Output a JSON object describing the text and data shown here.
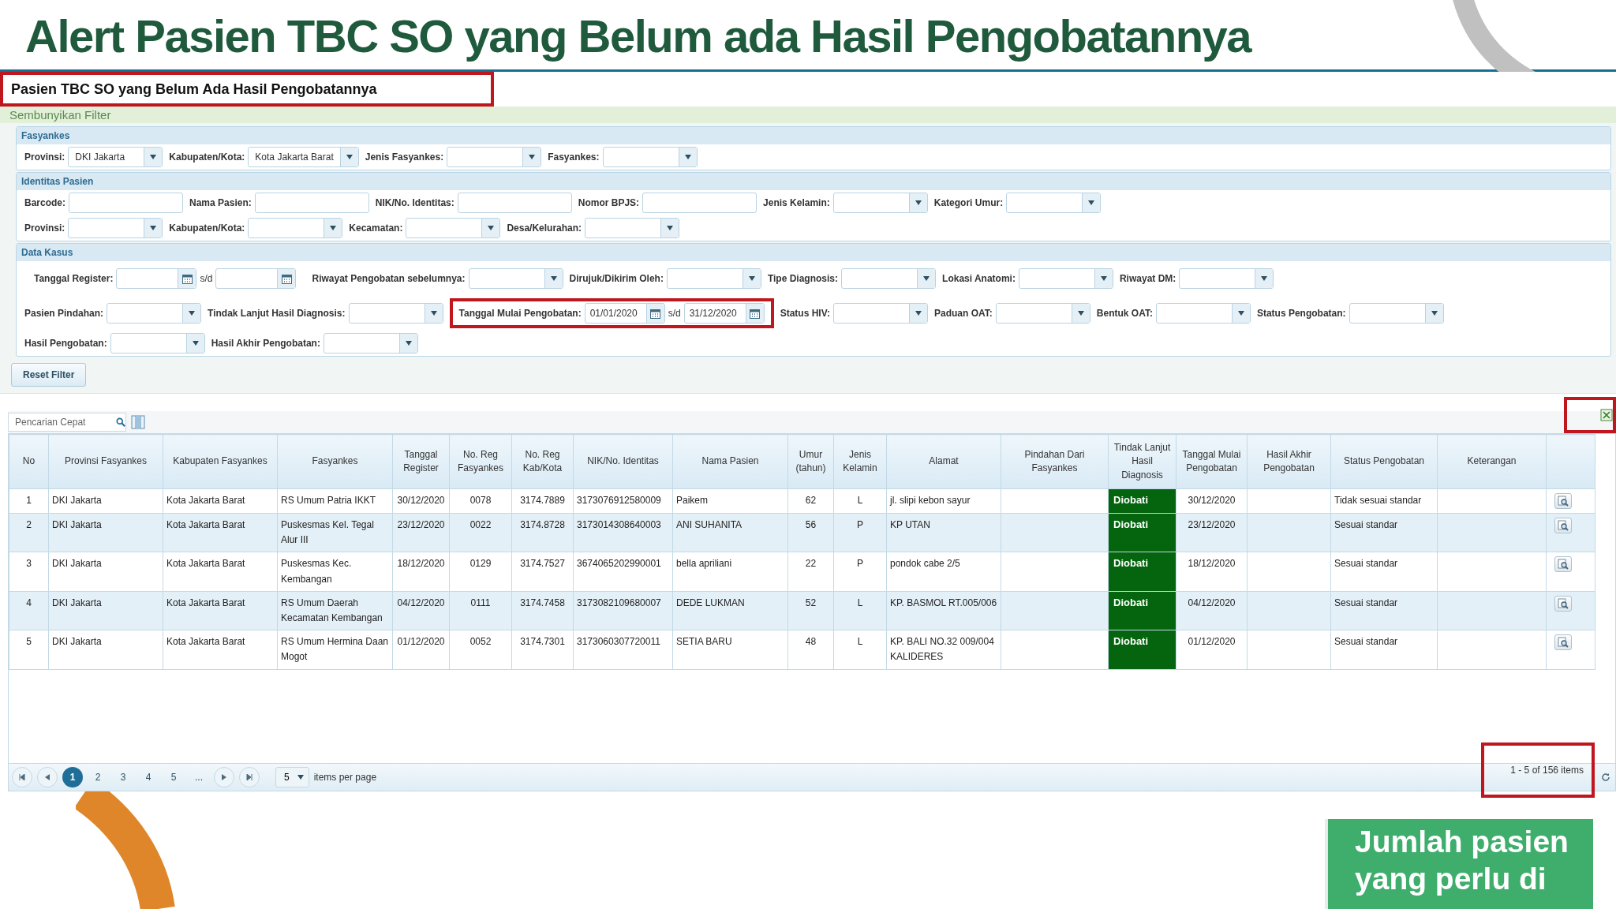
{
  "slide": {
    "title": "Alert Pasien TBC SO yang Belum ada Hasil Pengobatannya",
    "callout": "Jumlah pasien yang perlu di"
  },
  "panel": {
    "title": "Pasien TBC SO yang Belum Ada Hasil Pengobatannya",
    "title_highlighted": true,
    "filter_toggle": "Sembunyikan Filter"
  },
  "filter_groups": [
    {
      "title": "Fasyankes",
      "rows": [
        [
          {
            "label": "Provinsi:",
            "kind": "select",
            "value": "DKI Jakarta"
          },
          {
            "label": "Kabupaten/Kota:",
            "kind": "select",
            "value": "Kota Jakarta Barat"
          },
          {
            "label": "Jenis Fasyankes:",
            "kind": "select"
          },
          {
            "label": "Fasyankes:",
            "kind": "select"
          }
        ]
      ]
    },
    {
      "title": "Identitas Pasien",
      "rows": [
        [
          {
            "label": "Barcode:",
            "kind": "text"
          },
          {
            "label": "Nama Pasien:",
            "kind": "text"
          },
          {
            "label": "NIK/No. Identitas:",
            "kind": "text"
          },
          {
            "label": "Nomor BPJS:",
            "kind": "text"
          },
          {
            "label": "Jenis Kelamin:",
            "kind": "select"
          },
          {
            "label": "Kategori Umur:",
            "kind": "select"
          }
        ],
        [
          {
            "label": "Provinsi:",
            "kind": "select"
          },
          {
            "label": "Kabupaten/Kota:",
            "kind": "select"
          },
          {
            "label": "Kecamatan:",
            "kind": "select"
          },
          {
            "label": "Desa/Kelurahan:",
            "kind": "select"
          }
        ]
      ]
    },
    {
      "title": "Data Kasus",
      "rows": [
        [
          {
            "label": "Tanggal Register:",
            "kind": "date_range",
            "separator": "s/d"
          },
          {
            "label": "Riwayat Pengobatan sebelumnya:",
            "kind": "select"
          },
          {
            "label": "Dirujuk/Dikirim Oleh:",
            "kind": "select"
          },
          {
            "label": "Tipe Diagnosis:",
            "kind": "select"
          },
          {
            "label": "Lokasi Anatomi:",
            "kind": "select"
          },
          {
            "label": "Riwayat DM:",
            "kind": "select"
          }
        ],
        [
          {
            "label": "Pasien Pindahan:",
            "kind": "select"
          },
          {
            "label": "Tindak Lanjut Hasil Diagnosis:",
            "kind": "select"
          },
          {
            "label": "Tanggal Mulai Pengobatan:",
            "kind": "date_range",
            "from": "01/01/2020",
            "separator": "s/d",
            "to": "31/12/2020",
            "highlighted": true
          },
          {
            "label": "Status HIV:",
            "kind": "select"
          },
          {
            "label": "Paduan OAT:",
            "kind": "select"
          },
          {
            "label": "Bentuk OAT:",
            "kind": "select"
          },
          {
            "label": "Status Pengobatan:",
            "kind": "select"
          }
        ],
        [
          {
            "label": "Hasil Pengobatan:",
            "kind": "select"
          },
          {
            "label": "Hasil Akhir Pengobatan:",
            "kind": "select"
          }
        ]
      ]
    }
  ],
  "reset_button": "Reset Filter",
  "search": {
    "placeholder": "Pencarian Cepat"
  },
  "export_highlighted": true,
  "table": {
    "columns": [
      {
        "label": "No",
        "kind": "center"
      },
      {
        "label": "Provinsi Fasyankes",
        "kind": "text"
      },
      {
        "label": "Kabupaten Fasyankes",
        "kind": "text"
      },
      {
        "label": "Fasyankes",
        "kind": "text"
      },
      {
        "label": "Tanggal Register",
        "kind": "center"
      },
      {
        "label": "No. Reg Fasyankes",
        "kind": "center"
      },
      {
        "label": "No. Reg Kab/Kota",
        "kind": "center"
      },
      {
        "label": "NIK/No. Identitas",
        "kind": "text"
      },
      {
        "label": "Nama Pasien",
        "kind": "text"
      },
      {
        "label": "Umur (tahun)",
        "kind": "center"
      },
      {
        "label": "Jenis Kelamin",
        "kind": "center"
      },
      {
        "label": "Alamat",
        "kind": "text"
      },
      {
        "label": "Pindahan Dari Fasyankes",
        "kind": "text"
      },
      {
        "label": "Tindak Lanjut Hasil Diagnosis",
        "kind": "status"
      },
      {
        "label": "Tanggal Mulai Pengobatan",
        "kind": "center"
      },
      {
        "label": "Hasil Akhir Pengobatan",
        "kind": "text"
      },
      {
        "label": "Status Pengobatan",
        "kind": "text"
      },
      {
        "label": "Keterangan",
        "kind": "text"
      },
      {
        "kind": "action"
      }
    ],
    "rows": [
      [
        "1",
        "DKI Jakarta",
        "Kota Jakarta Barat",
        "RS Umum Patria IKKT",
        "30/12/2020",
        "0078",
        "3174.7889",
        "3173076912580009",
        "Paikem",
        "62",
        "L",
        "jl. slipi kebon sayur",
        null,
        "Diobati",
        "30/12/2020",
        null,
        "Tidak sesuai standar",
        null,
        null
      ],
      [
        "2",
        "DKI Jakarta",
        "Kota Jakarta Barat",
        "Puskesmas Kel. Tegal Alur III",
        "23/12/2020",
        "0022",
        "3174.8728",
        "3173014308640003",
        "ANI SUHANITA",
        "56",
        "P",
        "KP UTAN",
        null,
        "Diobati",
        "23/12/2020",
        null,
        "Sesuai standar",
        null,
        null
      ],
      [
        "3",
        "DKI Jakarta",
        "Kota Jakarta Barat",
        "Puskesmas Kec. Kembangan",
        "18/12/2020",
        "0129",
        "3174.7527",
        "3674065202990001",
        "bella apriliani",
        "22",
        "P",
        "pondok cabe 2/5",
        null,
        "Diobati",
        "18/12/2020",
        null,
        "Sesuai standar",
        null,
        null
      ],
      [
        "4",
        "DKI Jakarta",
        "Kota Jakarta Barat",
        "RS Umum Daerah Kecamatan Kembangan",
        "04/12/2020",
        "0111",
        "3174.7458",
        "3173082109680007",
        "DEDE LUKMAN",
        "52",
        "L",
        "KP. BASMOL RT.005/006",
        null,
        "Diobati",
        "04/12/2020",
        null,
        "Sesuai standar",
        null,
        null
      ],
      [
        "5",
        "DKI Jakarta",
        "Kota Jakarta Barat",
        "RS Umum Hermina Daan Mogot",
        "01/12/2020",
        "0052",
        "3174.7301",
        "3173060307720011",
        "SETIA BARU",
        "48",
        "L",
        "KP. BALI NO.32 009/004 KALIDERES",
        null,
        "Diobati",
        "01/12/2020",
        null,
        "Sesuai standar",
        null,
        null
      ]
    ]
  },
  "pager": {
    "pages": [
      {
        "label": "1",
        "selected": true
      },
      {
        "label": "2",
        "selected": false
      },
      {
        "label": "3",
        "selected": false
      },
      {
        "label": "4",
        "selected": false
      },
      {
        "label": "5",
        "selected": false
      },
      {
        "label": "...",
        "selected": false
      }
    ],
    "page_size": "5",
    "page_size_label": "items per page",
    "summary": "1 - 5 of 156 items",
    "summary_highlighted": true
  }
}
